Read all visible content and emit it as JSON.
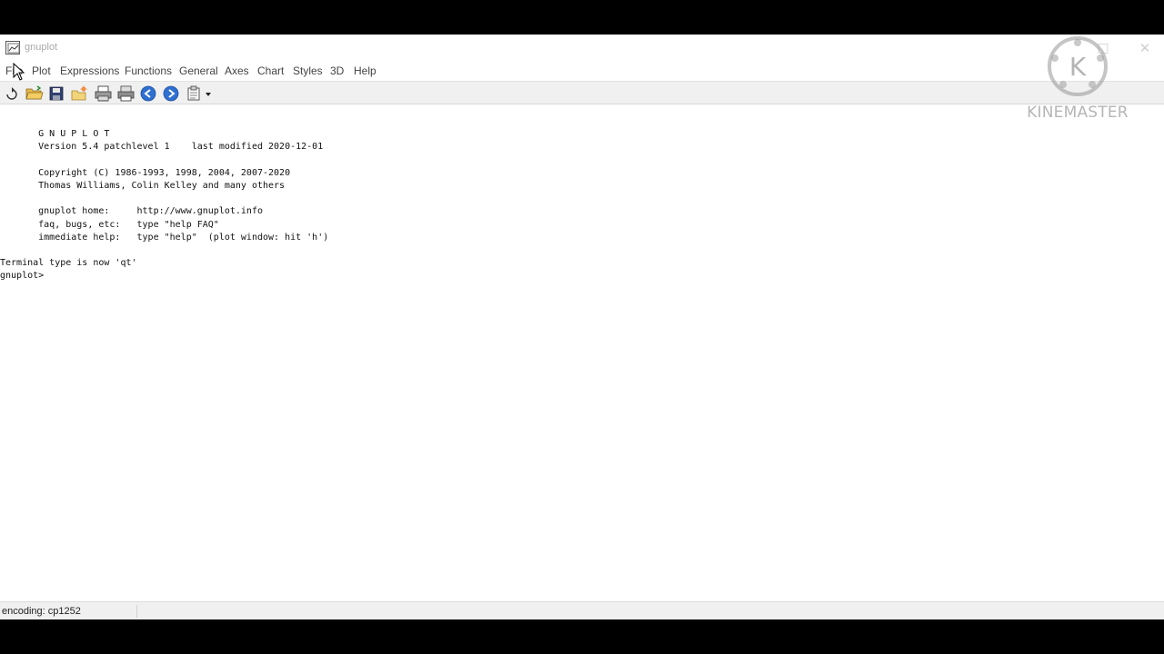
{
  "window": {
    "title": "gnuplot"
  },
  "menu": {
    "items": [
      "File",
      "Plot",
      "Expressions",
      "Functions",
      "General",
      "Axes",
      "Chart",
      "Styles",
      "3D",
      "Help"
    ]
  },
  "toolbar": {
    "icons": [
      "replot-icon",
      "open-folder-icon",
      "save-icon",
      "change-directory-icon",
      "print-icon",
      "print-setup-icon",
      "back-icon",
      "forward-icon",
      "options-dropdown-icon"
    ]
  },
  "console": {
    "lines": [
      "",
      "       G N U P L O T",
      "       Version 5.4 patchlevel 1    last modified 2020-12-01",
      "",
      "       Copyright (C) 1986-1993, 1998, 2004, 2007-2020",
      "       Thomas Williams, Colin Kelley and many others",
      "",
      "       gnuplot home:     http://www.gnuplot.info",
      "       faq, bugs, etc:   type \"help FAQ\"",
      "       immediate help:   type \"help\"  (plot window: hit 'h')",
      "",
      "Terminal type is now 'qt'",
      "gnuplot> "
    ]
  },
  "status": {
    "encoding": "encoding: cp1252"
  },
  "watermark": {
    "letter": "K",
    "text": "KINEMASTER"
  },
  "colors": {
    "background": "#ffffff",
    "toolbar": "#f0f0f0",
    "frame": "#000000",
    "text": "#111111"
  }
}
